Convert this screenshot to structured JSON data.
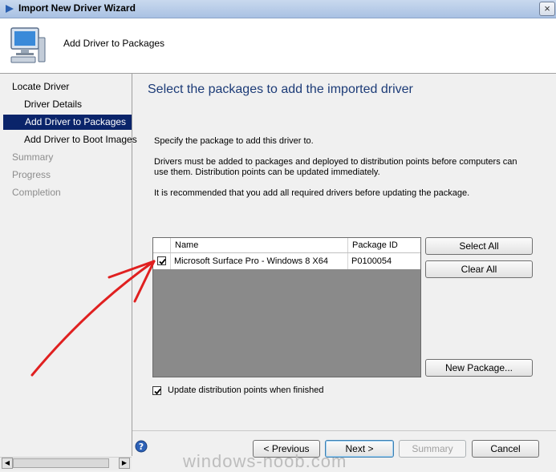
{
  "window": {
    "title": "Import New Driver Wizard",
    "close_glyph": "×"
  },
  "header": {
    "title": "Add Driver to Packages",
    "icon": "computer-icon"
  },
  "nav": {
    "items": [
      {
        "label": "Locate Driver",
        "state": "normal"
      },
      {
        "label": "Driver Details",
        "state": "normal"
      },
      {
        "label": "Add Driver to Packages",
        "state": "active"
      },
      {
        "label": "Add Driver to Boot Images",
        "state": "normal"
      },
      {
        "label": "Summary",
        "state": "disabled"
      },
      {
        "label": "Progress",
        "state": "disabled"
      },
      {
        "label": "Completion",
        "state": "disabled"
      }
    ]
  },
  "main": {
    "title": "Select the packages to add the imported driver",
    "para1": "Specify the package to add this driver to.",
    "para2": "Drivers must be added to packages and deployed to distribution points before computers can use them.  Distribution points can be updated immediately.",
    "para3": "It is recommended that you add all required drivers before updating the package."
  },
  "table": {
    "columns": [
      "Name",
      "Package ID"
    ],
    "rows": [
      {
        "checked": true,
        "name": "Microsoft Surface Pro - Windows 8 X64",
        "package_id": "P0100054"
      }
    ]
  },
  "buttons": {
    "select_all": "Select All",
    "clear_all": "Clear All",
    "new_package": "New Package...",
    "previous": "< Previous",
    "next": "Next >",
    "summary": "Summary",
    "cancel": "Cancel"
  },
  "update_dp": {
    "label": "Update distribution points when finished",
    "checked": true
  },
  "scrollbar": {
    "left_glyph": "◀",
    "right_glyph": "▶"
  },
  "help_glyph": "?",
  "watermark": "windows-noob.com",
  "colors": {
    "accent": "#0a246a",
    "title_text": "#1c3b77",
    "arrow": "#e02020"
  }
}
